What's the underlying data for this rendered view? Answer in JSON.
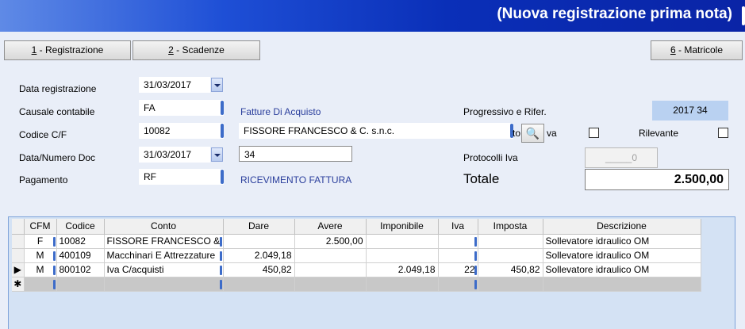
{
  "window": {
    "title": "(Nuova registrazione prima nota)"
  },
  "tabs": [
    {
      "key": "1",
      "label": " - Registrazione"
    },
    {
      "key": "2",
      "label": " - Scadenze"
    },
    {
      "key": "6",
      "label": " - Matricole"
    }
  ],
  "form": {
    "data_registrazione": {
      "label": "Data registrazione",
      "value": "31/03/2017"
    },
    "causale": {
      "label": "Causale contabile",
      "value": "FA",
      "description": "Fatture Di Acquisto"
    },
    "codice_cf": {
      "label": "Codice C/F",
      "value": "10082",
      "name": "FISSORE FRANCESCO & C. s.n.c."
    },
    "data_numero_doc": {
      "label": "Data/Numero Doc",
      "date": "31/03/2017",
      "number": "34"
    },
    "pagamento": {
      "label": "Pagamento",
      "value": "RF",
      "description": "RICEVIMENTO FATTURA"
    },
    "progressivo": {
      "label": "Progressivo e Rifer.",
      "value": "2017 34"
    },
    "iva_label": "to",
    "iva_label2": "va",
    "rilevante": {
      "label": "Rilevante"
    },
    "protocolli": {
      "label": "Protocolli Iva",
      "value": "_____0"
    },
    "totale": {
      "label": "Totale",
      "value": "2.500,00"
    }
  },
  "grid": {
    "columns": [
      "CFM",
      "Codice",
      "Conto",
      "Dare",
      "Avere",
      "Imponibile",
      "Iva",
      "Imposta",
      "Descrizione"
    ],
    "rows": [
      {
        "cfm": "F",
        "codice": "10082",
        "conto": "FISSORE FRANCESCO &",
        "dare": "",
        "avere": "2.500,00",
        "imponibile": "",
        "iva": "",
        "imposta": "",
        "descrizione": "Sollevatore idraulico OM"
      },
      {
        "cfm": "M",
        "codice": "400109",
        "conto": "Macchinari E Attrezzature",
        "dare": "2.049,18",
        "avere": "",
        "imponibile": "",
        "iva": "",
        "imposta": "",
        "descrizione": "Sollevatore idraulico OM"
      },
      {
        "cfm": "M",
        "codice": "800102",
        "conto": "Iva C/acquisti",
        "dare": "450,82",
        "avere": "",
        "imponibile": "2.049,18",
        "iva": "22",
        "imposta": "450,82",
        "descrizione": "Sollevatore idraulico OM"
      }
    ],
    "current_row_marker": "▶",
    "new_row_marker": "✱"
  },
  "colors": {
    "title_bar": "#0a2fb8",
    "accent": "#3d6cc9",
    "background": "#e9eef8"
  }
}
